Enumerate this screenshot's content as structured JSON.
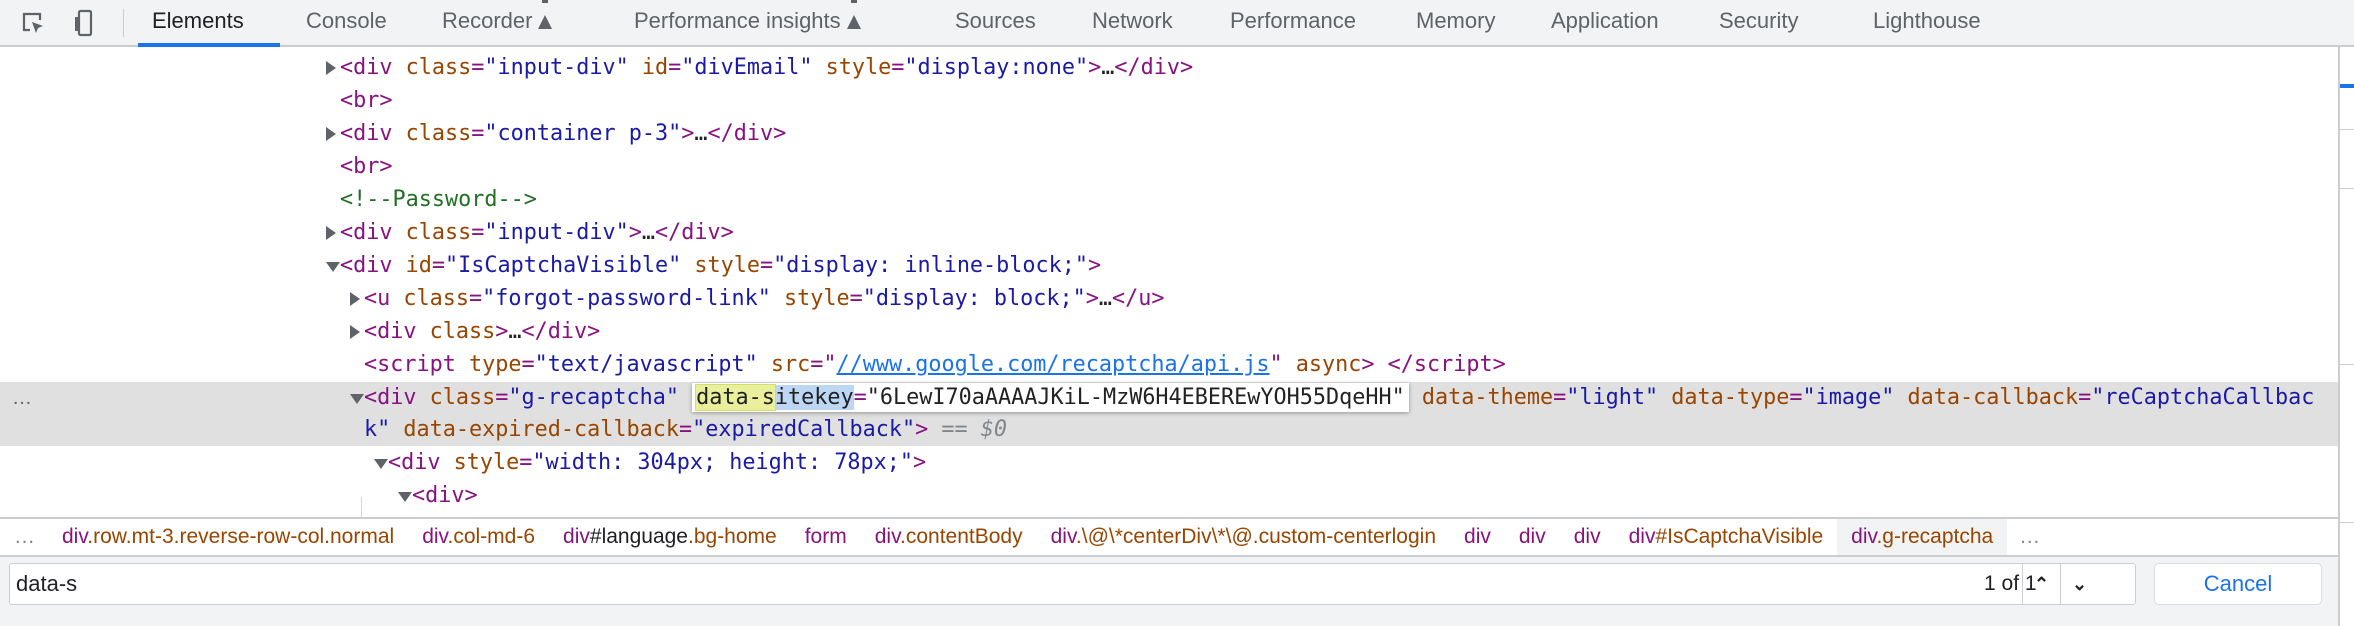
{
  "toolbar": {
    "tabs": [
      {
        "label": "Elements",
        "active": true
      },
      {
        "label": "Console"
      },
      {
        "label": "Recorder",
        "icon": "flask-icon"
      },
      {
        "label": "Performance insights",
        "icon": "flask-icon"
      },
      {
        "label": "Sources"
      },
      {
        "label": "Network"
      },
      {
        "label": "Performance"
      },
      {
        "label": "Memory"
      },
      {
        "label": "Application"
      },
      {
        "label": "Security"
      },
      {
        "label": "Lighthouse"
      }
    ],
    "accent": "#1a73e8"
  },
  "elements": {
    "selected_row_marker": "…",
    "rows": [
      {
        "depth": 0,
        "arrow": "collapsed",
        "tokens": [
          [
            "tag",
            "<div"
          ],
          [
            "an",
            " class"
          ],
          [
            "tag",
            "="
          ],
          [
            "av",
            "\"input-div\""
          ],
          [
            "an",
            " id"
          ],
          [
            "tag",
            "="
          ],
          [
            "av",
            "\"divEmail\""
          ],
          [
            "an",
            " style"
          ],
          [
            "tag",
            "="
          ],
          [
            "av",
            "\"display:none\""
          ],
          [
            "tag",
            ">"
          ],
          [
            "p",
            "…"
          ],
          [
            "tag",
            "</div>"
          ]
        ]
      },
      {
        "depth": 0,
        "arrow": "none",
        "tokens": [
          [
            "tag",
            "<br>"
          ]
        ]
      },
      {
        "depth": 0,
        "arrow": "collapsed",
        "tokens": [
          [
            "tag",
            "<div"
          ],
          [
            "an",
            " class"
          ],
          [
            "tag",
            "="
          ],
          [
            "av",
            "\"container p-3\""
          ],
          [
            "tag",
            ">"
          ],
          [
            "p",
            "…"
          ],
          [
            "tag",
            "</div>"
          ]
        ]
      },
      {
        "depth": 0,
        "arrow": "none",
        "tokens": [
          [
            "tag",
            "<br>"
          ]
        ]
      },
      {
        "depth": 0,
        "arrow": "none",
        "tokens": [
          [
            "cm",
            "<!--Password-->"
          ]
        ]
      },
      {
        "depth": 0,
        "arrow": "collapsed",
        "tokens": [
          [
            "tag",
            "<div"
          ],
          [
            "an",
            " class"
          ],
          [
            "tag",
            "="
          ],
          [
            "av",
            "\"input-div\""
          ],
          [
            "tag",
            ">"
          ],
          [
            "p",
            "…"
          ],
          [
            "tag",
            "</div>"
          ]
        ]
      },
      {
        "depth": 0,
        "arrow": "expanded",
        "tokens": [
          [
            "tag",
            "<div"
          ],
          [
            "an",
            " id"
          ],
          [
            "tag",
            "="
          ],
          [
            "av",
            "\"IsCaptchaVisible\""
          ],
          [
            "an",
            " style"
          ],
          [
            "tag",
            "="
          ],
          [
            "av",
            "\"display: inline-block;\""
          ],
          [
            "tag",
            ">"
          ]
        ]
      },
      {
        "depth": 1,
        "arrow": "collapsed",
        "tokens": [
          [
            "tag",
            "<u"
          ],
          [
            "an",
            " class"
          ],
          [
            "tag",
            "="
          ],
          [
            "av",
            "\"forgot-password-link\""
          ],
          [
            "an",
            " style"
          ],
          [
            "tag",
            "="
          ],
          [
            "av",
            "\"display: block;\""
          ],
          [
            "tag",
            ">"
          ],
          [
            "p",
            "…"
          ],
          [
            "tag",
            "</u>"
          ]
        ]
      },
      {
        "depth": 1,
        "arrow": "collapsed",
        "tokens": [
          [
            "tag",
            "<div"
          ],
          [
            "an",
            " class"
          ],
          [
            "tag",
            ">"
          ],
          [
            "p",
            "…"
          ],
          [
            "tag",
            "</div>"
          ]
        ]
      },
      {
        "depth": 1,
        "arrow": "none",
        "tokens": [
          [
            "tag",
            "<script"
          ],
          [
            "an",
            " type"
          ],
          [
            "tag",
            "="
          ],
          [
            "av",
            "\"text/javascript\""
          ],
          [
            "an",
            " src"
          ],
          [
            "tag",
            "=\""
          ],
          [
            "link",
            "//www.google.com/recaptcha/api.js"
          ],
          [
            "tag",
            "\""
          ],
          [
            "an",
            " async"
          ],
          [
            "tag",
            ">"
          ],
          [
            "p",
            " "
          ],
          [
            "tag",
            "</script>"
          ]
        ]
      },
      {
        "depth": 1,
        "arrow": "expanded",
        "selected": true,
        "tokens": [
          [
            "tag",
            "<div"
          ],
          [
            "an",
            " class"
          ],
          [
            "tag",
            "="
          ],
          [
            "av",
            "\"g-recaptcha\""
          ],
          [
            "p",
            " "
          ],
          [
            "box",
            [
              [
                "m1",
                "data-s"
              ],
              [
                "m2",
                "itekey"
              ],
              [
                "tag",
                "="
              ],
              [
                "p",
                "\"6LewI70aAAAAJKiL-MzW6H4EBEREwYOH55DqeHH\""
              ]
            ]
          ],
          [
            "an",
            " data-theme"
          ],
          [
            "tag",
            "="
          ],
          [
            "av",
            "\"light\""
          ],
          [
            "an",
            " data-type"
          ],
          [
            "tag",
            "="
          ],
          [
            "av",
            "\"image\""
          ],
          [
            "an",
            " data-callback"
          ],
          [
            "tag",
            "="
          ],
          [
            "av",
            "\"reCaptchaCallback\""
          ],
          [
            "an",
            " data-expired-callback"
          ],
          [
            "tag",
            "="
          ],
          [
            "av",
            "\"expiredCallback\""
          ],
          [
            "tag",
            ">"
          ],
          [
            "eq",
            " == "
          ],
          [
            "dollar",
            "$0"
          ]
        ]
      },
      {
        "depth": 2,
        "arrow": "expanded",
        "tokens": [
          [
            "tag",
            "<div"
          ],
          [
            "an",
            " style"
          ],
          [
            "tag",
            "="
          ],
          [
            "av",
            "\"width: 304px; height: 78px;\""
          ],
          [
            "tag",
            ">"
          ]
        ]
      },
      {
        "depth": 3,
        "arrow": "expanded",
        "tokens": [
          [
            "tag",
            "<div>"
          ]
        ]
      }
    ]
  },
  "breadcrumbs": {
    "more_left": "…",
    "more_right": "…",
    "items": [
      [
        [
          "c-tag",
          "div"
        ],
        [
          "c-cls",
          ".row.mt-3.reverse-row-col.normal"
        ]
      ],
      [
        [
          "c-tag",
          "div"
        ],
        [
          "c-cls",
          ".col-md-6"
        ]
      ],
      [
        [
          "c-tag",
          "div"
        ],
        [
          "c-id",
          "#language"
        ],
        [
          "c-cls",
          ".bg-home"
        ]
      ],
      [
        [
          "c-tag",
          "form"
        ]
      ],
      [
        [
          "c-tag",
          "div"
        ],
        [
          "c-cls",
          ".contentBody"
        ]
      ],
      [
        [
          "c-tag",
          "div"
        ],
        [
          "c-cls",
          ".\\@\\*centerDiv\\*\\@.custom-centerlogin"
        ]
      ],
      [
        [
          "c-tag",
          "div"
        ]
      ],
      [
        [
          "c-tag",
          "div"
        ]
      ],
      [
        [
          "c-tag",
          "div"
        ]
      ],
      [
        [
          "c-tag",
          "div"
        ],
        [
          "c-cls",
          "#IsCaptchaVisible"
        ]
      ],
      [
        [
          "c-tag",
          "div"
        ],
        [
          "c-cls",
          ".g-recaptcha"
        ]
      ]
    ],
    "selected_index": 10
  },
  "search": {
    "value": "data-s",
    "match_count": "1 of 1",
    "prev_label": "⌃",
    "next_label": "⌄",
    "cancel_label": "Cancel"
  }
}
